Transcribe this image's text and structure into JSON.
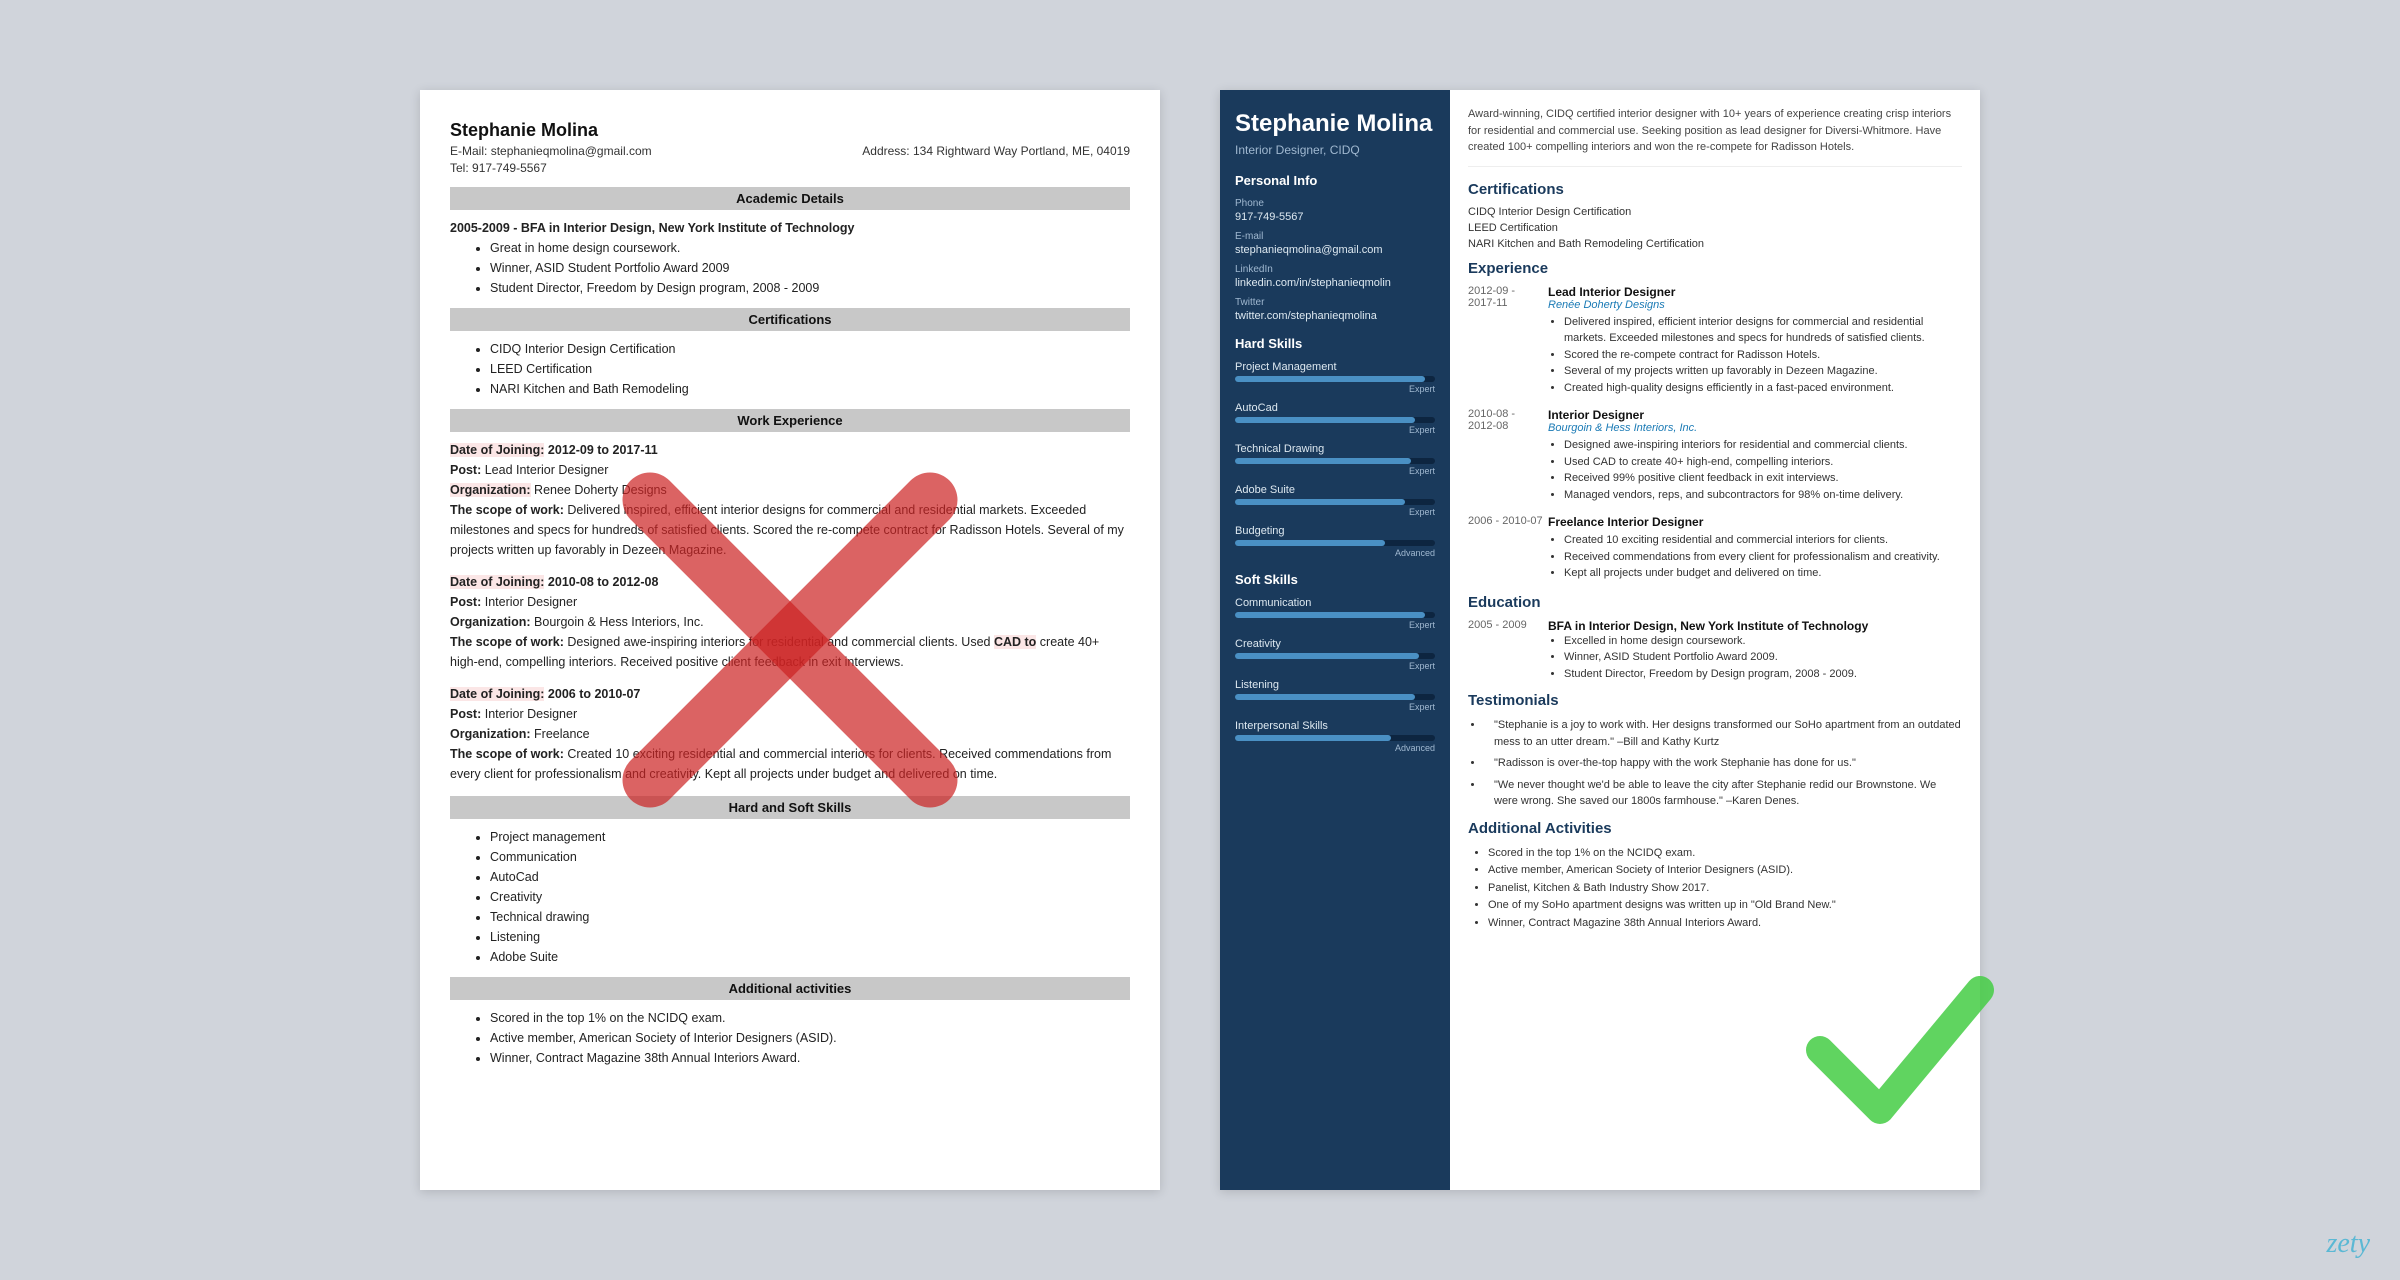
{
  "left_resume": {
    "name": "Stephanie Molina",
    "email_label": "E-Mail:",
    "email": "stephanieqmolina@gmail.com",
    "address_label": "Address:",
    "address": "134 Rightward Way Portland, ME, 04019",
    "tel_label": "Tel:",
    "tel": "917-749-5567",
    "sections": {
      "academic": {
        "title": "Academic Details",
        "entries": [
          {
            "year": "2005-2009 -",
            "degree": "BFA in Interior Design, New York Institute of Technology",
            "bullets": [
              "Great in home design coursework.",
              "Winner, ASID Student Portfolio Award 2009",
              "Student Director, Freedom by Design program, 2008 - 2009"
            ]
          }
        ]
      },
      "certifications": {
        "title": "Certifications",
        "items": [
          "CIDQ Interior Design Certification",
          "LEED Certification",
          "NARI Kitchen and Bath Remodeling"
        ]
      },
      "work": {
        "title": "Work Experience",
        "entries": [
          {
            "date_label": "Date of Joining:",
            "date": "2012-09 to 2017-11",
            "post_label": "Post:",
            "post": "Lead Interior Designer",
            "org_label": "Organization:",
            "org": "Renee Doherty Designs",
            "scope_label": "The scope of work:",
            "scope": "Delivered inspired, efficient interior designs for commercial and residential markets. Exceeded milestones and specs for hundreds of satisfied clients. Scored the re-compete contract for Radisson Hotels. Several of my projects written up favorably in Dezeen Magazine."
          },
          {
            "date_label": "Date of Joining:",
            "date": "2010-08 to 2012-08",
            "post_label": "Post:",
            "post": "Interior Designer",
            "org_label": "Organization:",
            "org": "Bourgoin & Hess Interiors, Inc.",
            "scope_label": "The scope of work:",
            "scope": "Designed awe-inspiring interiors for residential and commercial clients. Used CAD to create 40+ high-end, compelling interiors. Received positive client feedback in exit interviews."
          },
          {
            "date_label": "Date of Joining:",
            "date": "2006 to 2010-07",
            "post_label": "Post:",
            "post": "Interior Designer",
            "org_label": "Organization:",
            "org": "Freelance",
            "scope_label": "The scope of work:",
            "scope": "Created 10 exciting residential and commercial interiors for clients. Received commendations from every client for professionalism and creativity. Kept all projects under budget and delivered on time."
          }
        ]
      },
      "skills": {
        "title": "Hard and Soft Skills",
        "items": [
          "Project management",
          "Communication",
          "AutoCad",
          "Creativity",
          "Technical drawing",
          "Listening",
          "Adobe Suite"
        ]
      },
      "activities": {
        "title": "Additional activities",
        "items": [
          "Scored in the top 1% on the NCIDQ exam.",
          "Active member, American Society of Interior Designers (ASID).",
          "Winner, Contract Magazine 38th Annual Interiors Award."
        ]
      }
    }
  },
  "right_resume": {
    "name": "Stephanie Molina",
    "title": "Interior Designer, CIDQ",
    "summary": "Award-winning, CIDQ certified interior designer with 10+ years of experience creating crisp interiors for residential and commercial use. Seeking position as lead designer for Diversi-Whitmore. Have created 100+ compelling interiors and won the re-compete for Radisson Hotels.",
    "personal_info": {
      "section_title": "Personal Info",
      "phone_label": "Phone",
      "phone": "917-749-5567",
      "email_label": "E-mail",
      "email": "stephanieqmolina@gmail.com",
      "linkedin_label": "LinkedIn",
      "linkedin": "linkedin.com/in/stephanieqmolin",
      "twitter_label": "Twitter",
      "twitter": "twitter.com/stephanieqmolina"
    },
    "hard_skills": {
      "section_title": "Hard Skills",
      "items": [
        {
          "name": "Project Management",
          "level": "Expert",
          "pct": 95
        },
        {
          "name": "AutoCad",
          "level": "Expert",
          "pct": 90
        },
        {
          "name": "Technical Drawing",
          "level": "Expert",
          "pct": 88
        },
        {
          "name": "Adobe Suite",
          "level": "Expert",
          "pct": 85
        },
        {
          "name": "Budgeting",
          "level": "Advanced",
          "pct": 75
        }
      ]
    },
    "soft_skills": {
      "section_title": "Soft Skills",
      "items": [
        {
          "name": "Communication",
          "level": "Expert",
          "pct": 95
        },
        {
          "name": "Creativity",
          "level": "Expert",
          "pct": 92
        },
        {
          "name": "Listening",
          "level": "Expert",
          "pct": 90
        },
        {
          "name": "Interpersonal Skills",
          "level": "Advanced",
          "pct": 78
        }
      ]
    },
    "certifications": {
      "section_title": "Certifications",
      "items": [
        "CIDQ Interior Design Certification",
        "LEED Certification",
        "NARI Kitchen and Bath Remodeling Certification"
      ]
    },
    "experience": {
      "section_title": "Experience",
      "entries": [
        {
          "dates": "2012-09 - 2017-11",
          "job_title": "Lead Interior Designer",
          "company": "Renée Doherty Designs",
          "bullets": [
            "Delivered inspired, efficient interior designs for commercial and residential markets. Exceeded milestones and specs for hundreds of satisfied clients.",
            "Scored the re-compete contract for Radisson Hotels.",
            "Several of my projects written up favorably in Dezeen Magazine.",
            "Created high-quality designs efficiently in a fast-paced environment."
          ]
        },
        {
          "dates": "2010-08 - 2012-08",
          "job_title": "Interior Designer",
          "company": "Bourgoin & Hess Interiors, Inc.",
          "bullets": [
            "Designed awe-inspiring interiors for residential and commercial clients.",
            "Used CAD to create 40+ high-end, compelling interiors.",
            "Received 99% positive client feedback in exit interviews.",
            "Managed vendors, reps, and subcontractors for 98% on-time delivery."
          ]
        },
        {
          "dates": "2006 - 2010-07",
          "job_title": "Freelance Interior Designer",
          "company": "",
          "bullets": [
            "Created 10 exciting residential and commercial interiors for clients.",
            "Received commendations from every client for professionalism and creativity.",
            "Kept all projects under budget and delivered on time."
          ]
        }
      ]
    },
    "education": {
      "section_title": "Education",
      "entries": [
        {
          "dates": "2005 - 2009",
          "degree": "BFA in Interior Design, New York Institute of Technology",
          "bullets": [
            "Excelled in home design coursework.",
            "Winner, ASID Student Portfolio Award 2009.",
            "Student Director, Freedom by Design program, 2008 - 2009."
          ]
        }
      ]
    },
    "testimonials": {
      "section_title": "Testimonials",
      "items": [
        "\"Stephanie is a joy to work with. Her designs transformed our SoHo apartment from an outdated mess to an utter dream.\" –Bill and Kathy Kurtz",
        "\"Radisson is over-the-top happy with the work Stephanie has done for us.\"",
        "\"We never thought we'd be able to leave the city after Stephanie redid our Brownstone. We were wrong. She saved our 1800s farmhouse.\" –Karen Denes."
      ]
    },
    "additional_activities": {
      "section_title": "Additional Activities",
      "items": [
        "Scored in the top 1% on the NCIDQ exam.",
        "Active member, American Society of Interior Designers (ASID).",
        "Panelist, Kitchen & Bath Industry Show 2017.",
        "One of my SoHo apartment designs was written up in \"Old Brand New.\"",
        "Winner, Contract Magazine 38th Annual Interiors Award."
      ]
    }
  },
  "watermark": "zety"
}
